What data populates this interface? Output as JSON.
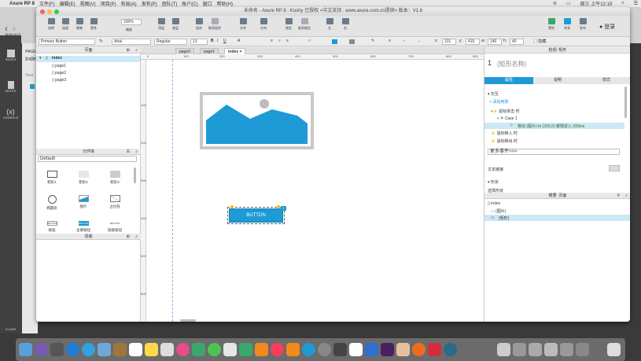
{
  "menubar": {
    "app": "Axure RP 8",
    "items": [
      "文件(F)",
      "编辑(E)",
      "视图(V)",
      "项目(P)",
      "布局(A)",
      "发布(P)",
      "团队(T)",
      "账户(C)",
      "窗口",
      "帮助(H)"
    ],
    "clock": "周三 上午12:19"
  },
  "window": {
    "title": "未命名 - Axure RP 8 : Koshy 已授权    <中文支持 : www.axure.com.cn提供> 版本：V1.6"
  },
  "toolbar": {
    "buttons": [
      "选择",
      "连接",
      "钢笔",
      "更多",
      "",
      "缩放",
      "",
      "顶层",
      "底层",
      "",
      "组合",
      "取消组合",
      "",
      "对齐",
      "分布",
      "",
      "锁定",
      "取消锁定",
      "",
      "左",
      "右"
    ],
    "zoom": "100%",
    "right_buttons": [
      "预览",
      "共享",
      "发布"
    ],
    "login": "登录"
  },
  "format": {
    "style": "Primary Button",
    "font": "Arial",
    "weight": "Regular",
    "size": "13",
    "x_label": "x:",
    "x": "131",
    "y_label": "y:",
    "y": "415",
    "w_label": "w:",
    "w": "140",
    "h_label": "h:",
    "h": "40",
    "hide": "隐藏"
  },
  "bg": {
    "pages_label": "PAGE",
    "page_name": "Inde",
    "search": "Sear",
    "back_label": "最常访问"
  },
  "leftbar": {
    "items": [
      "PAGES",
      "NOTES",
      "CONSOLE"
    ],
    "close": "CLOSE"
  },
  "pages": {
    "header": "页面",
    "tree": [
      "index",
      "page1",
      "page2",
      "page3"
    ]
  },
  "library": {
    "header": "元件库",
    "selected": "Default",
    "widgets": [
      "矩形1",
      "矩形2",
      "矩形3",
      "椭圆形",
      "图片",
      "占位符",
      "按钮",
      "主要按钮",
      "链接按钮"
    ],
    "mini_labels": [
      "BUTTON",
      "BUTTON",
      "BUTTON"
    ]
  },
  "masters": {
    "header": "母版"
  },
  "tabs": [
    "page3",
    "page1",
    "index"
  ],
  "ruler": {
    "h": [
      "0",
      "100",
      "200",
      "300",
      "400",
      "500",
      "600",
      "700",
      "800",
      "900",
      "1000"
    ],
    "v": [
      "100",
      "200",
      "300",
      "400",
      "500",
      "600",
      "700"
    ]
  },
  "canvas": {
    "button_label": "BUTTON",
    "badge": "1"
  },
  "inspector": {
    "header": "检视: 矩形",
    "number": "1",
    "name_placeholder": "(矩形名称)",
    "tabs": [
      "属性",
      "说明",
      "样式"
    ],
    "interaction": "交互",
    "add_case": "添加用例",
    "events": [
      "鼠标单击 时",
      "Case 1",
      "移动 (图片) to (200,0) 缓慢进入 200ms",
      "鼠标移入 时",
      "鼠标移出 时"
    ],
    "more_events": "更多事件>>>",
    "text_link": "文本链接",
    "shape": "形状",
    "select_shape": "选择形状"
  },
  "outline": {
    "header": "概要: 页面",
    "items": [
      "index",
      "(图片)",
      "(矩形)"
    ]
  },
  "colors": {
    "accent": "#1e9ad6",
    "selected_row": "#cde8f6"
  }
}
